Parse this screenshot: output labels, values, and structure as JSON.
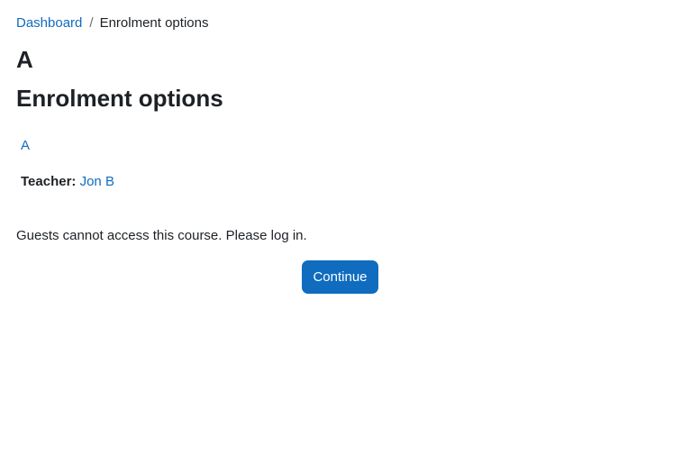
{
  "breadcrumb": {
    "items": [
      {
        "label": "Dashboard"
      },
      {
        "label": "Enrolment options"
      }
    ],
    "separator": "/"
  },
  "course": {
    "title": "A",
    "link_label": "A",
    "teacher_label": "Teacher:",
    "teacher_name": "Jon B"
  },
  "page": {
    "heading": "Enrolment options"
  },
  "notice": {
    "message": "Guests cannot access this course. Please log in."
  },
  "actions": {
    "continue_label": "Continue"
  },
  "colors": {
    "link": "#0f6cbf",
    "primary_button": "#0f6cbf",
    "text": "#1d2125"
  }
}
